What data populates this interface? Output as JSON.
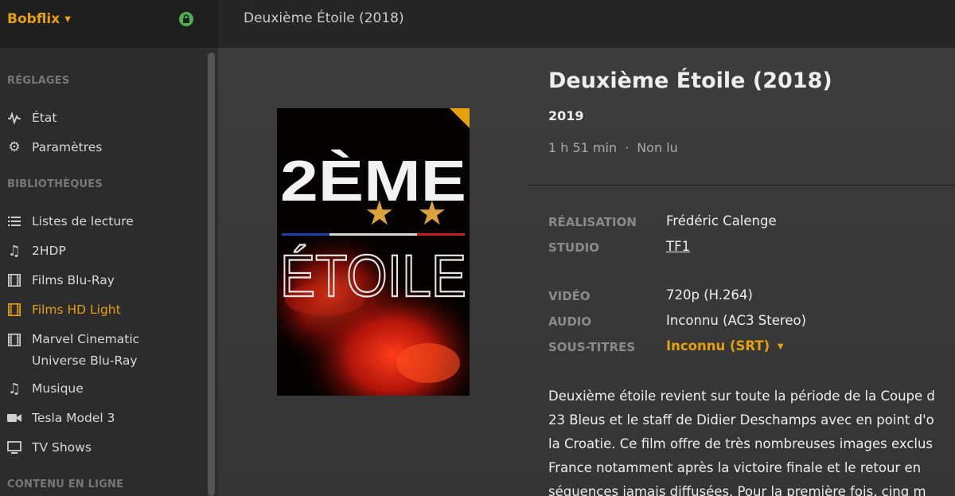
{
  "sidebar": {
    "brand": "Bobflix",
    "sections": {
      "settings": "RÉGLAGES",
      "libraries": "BIBLIOTHÈQUES",
      "online": "CONTENU EN LIGNE"
    },
    "settings_items": [
      {
        "label": "État",
        "icon": "activity-icon"
      },
      {
        "label": "Paramètres",
        "icon": "gear-icon"
      }
    ],
    "library_items": [
      {
        "label": "Listes de lecture",
        "icon": "list-icon"
      },
      {
        "label": "2HDP",
        "icon": "music-note-icon"
      },
      {
        "label": "Films Blu-Ray",
        "icon": "film-icon"
      },
      {
        "label": "Films HD Light",
        "icon": "film-icon",
        "active": true
      },
      {
        "label": "Marvel Cinematic",
        "label2": "Universe Blu-Ray",
        "icon": "film-icon"
      },
      {
        "label": "Musique",
        "icon": "music-note-icon"
      },
      {
        "label": "Tesla Model 3",
        "icon": "video-camera-icon"
      },
      {
        "label": "TV Shows",
        "icon": "monitor-icon"
      }
    ]
  },
  "topbar": {
    "title": "Deuxième Étoile (2018)"
  },
  "poster": {
    "line1": "2ÈME",
    "line2": "ÉTOILE"
  },
  "details": {
    "title": "Deuxième Étoile (2018)",
    "year": "2019",
    "duration": "1 h 51 min",
    "separator": "·",
    "status": "Non lu",
    "rows": {
      "director_label": "RÉALISATION",
      "director_value": "Frédéric Calenge",
      "studio_label": "STUDIO",
      "studio_value": "TF1",
      "video_label": "VIDÉO",
      "video_value": "720p (H.264)",
      "audio_label": "AUDIO",
      "audio_value": "Inconnu (AC3 Stereo)",
      "subtitles_label": "SOUS-TITRES",
      "subtitles_value": "Inconnu (SRT)"
    },
    "summary_lines": [
      "Deuxième étoile revient sur toute la période de la Coupe d",
      "23 Bleus et le staff de Didier Deschamps avec en point d'o",
      "la Croatie. Ce film offre de très nombreuses images exclus",
      "France notamment après la victoire finale et le retour en",
      "séquences jamais diffusées. Pour la première fois, cinq m"
    ]
  },
  "colors": {
    "accent": "#e5a00d",
    "sidebar_bg": "#2c2c2c",
    "main_bg": "#3a3a3a"
  }
}
